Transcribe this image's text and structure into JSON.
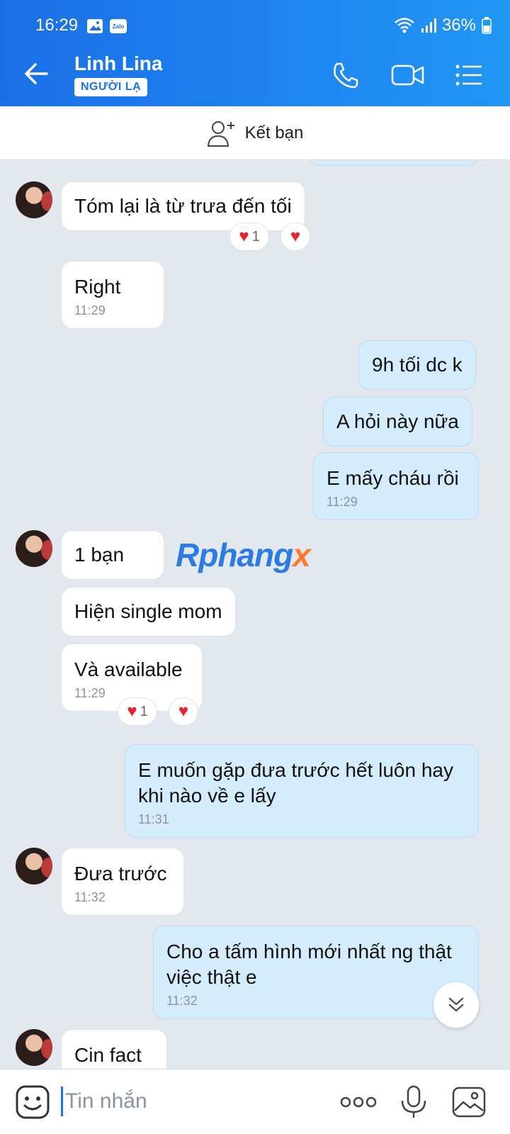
{
  "status": {
    "time": "16:29",
    "battery": "36%"
  },
  "header": {
    "contact_name": "Linh Lina",
    "badge": "NGƯỜI LẠ"
  },
  "add_friend": {
    "label": "Kết bạn"
  },
  "messages": [
    {
      "text": "Tóm lại là từ trưa đến tối"
    },
    {
      "text": "Right",
      "time": "11:29"
    },
    {
      "text": "9h tối dc k"
    },
    {
      "text": "A hỏi này nữa"
    },
    {
      "text": "E mấy cháu rồi",
      "time": "11:29"
    },
    {
      "text": "1 bạn"
    },
    {
      "text": "Hiện single mom"
    },
    {
      "text": "Và available",
      "time": "11:29"
    },
    {
      "line1": "E muốn gặp đưa trước hết luôn hay",
      "line2": "khi nào về e lấy",
      "time": "11:31"
    },
    {
      "text": "Đưa trước",
      "time": "11:32"
    },
    {
      "line1": "Cho a tấm hình mới nhất ng thật",
      "line2": "việc thật e",
      "time": "11:32"
    },
    {
      "text": "Cin fact"
    }
  ],
  "reactions": {
    "count_1": "1",
    "count_2": "1"
  },
  "watermark": {
    "part1": "Rphang",
    "part2": "x"
  },
  "input": {
    "placeholder": "Tin nhắn"
  },
  "colors": {
    "header": "#1e86f2",
    "outgoing_bubble": "#d5ecfc",
    "incoming_bubble": "#ffffff",
    "heart": "#e5252d"
  }
}
